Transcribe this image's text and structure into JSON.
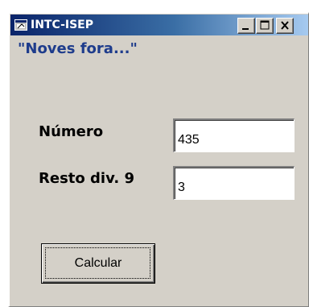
{
  "window": {
    "title": "INTC-ISEP",
    "icon": "app-window-icon",
    "controls": [
      "minimize-icon",
      "maximize-icon",
      "close-icon"
    ]
  },
  "form": {
    "heading": "\"Noves fora...\"",
    "numero_label": "Número",
    "numero_value": "435",
    "resto_label": "Resto div. 9",
    "resto_value": "3",
    "calc_button": "Calcular"
  },
  "colors": {
    "titlebar_start": "#0a246a",
    "titlebar_end": "#a6caf0",
    "heading": "#1e3c8c",
    "face": "#d4d0c8"
  }
}
